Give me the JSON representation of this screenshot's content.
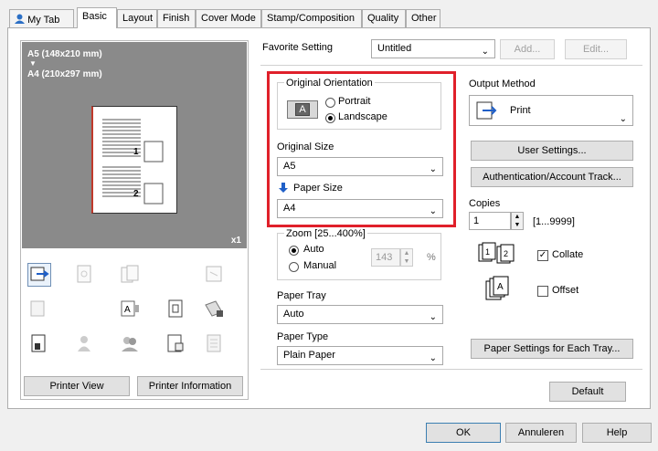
{
  "tabs": [
    "My Tab",
    "Basic",
    "Layout",
    "Finish",
    "Cover Mode",
    "Stamp/Composition",
    "Quality",
    "Other"
  ],
  "preview": {
    "original_size": "A5 (148x210 mm)",
    "arrow": "▼",
    "paper_size": "A4 (210x297 mm)",
    "copies_badge": "x1",
    "marker_1": "1",
    "marker_2": "2"
  },
  "favorite": {
    "label": "Favorite Setting",
    "value": "Untitled",
    "add": "Add...",
    "edit": "Edit..."
  },
  "orientation": {
    "label": "Original Orientation",
    "portrait": "Portrait",
    "landscape": "Landscape",
    "selected": "Landscape",
    "icon_letter": "A"
  },
  "original_size": {
    "label": "Original Size",
    "value": "A5"
  },
  "paper_size": {
    "label": "Paper Size",
    "value": "A4"
  },
  "zoom": {
    "label": "Zoom [25...400%]",
    "auto": "Auto",
    "manual": "Manual",
    "value": "143",
    "unit": "%"
  },
  "paper_tray": {
    "label": "Paper Tray",
    "value": "Auto"
  },
  "paper_type": {
    "label": "Paper Type",
    "value": "Plain Paper"
  },
  "output": {
    "label": "Output Method",
    "value": "Print"
  },
  "user_settings": "User Settings...",
  "auth": "Authentication/Account Track...",
  "copies": {
    "label": "Copies",
    "value": "1",
    "range": "[1...9999]"
  },
  "collate": {
    "label": "Collate",
    "checked": true
  },
  "offset": {
    "label": "Offset",
    "checked": false
  },
  "paper_settings_tray": "Paper Settings for Each Tray...",
  "default_btn": "Default",
  "printer_view": "Printer View",
  "printer_info": "Printer Information",
  "footer": {
    "ok": "OK",
    "cancel": "Annuleren",
    "help": "Help"
  },
  "colors": {
    "highlight": "#e0202a",
    "preview_bg": "#8a8a8a",
    "accent_blue": "#1f5fc8"
  }
}
